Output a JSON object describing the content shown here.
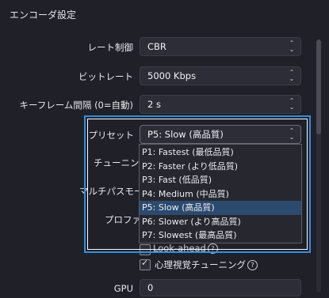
{
  "section_title": "エンコーダ設定",
  "rate_control": {
    "label": "レート制御",
    "value": "CBR"
  },
  "bitrate": {
    "label": "ビットレート",
    "value": "5000 Kbps"
  },
  "keyframe": {
    "label": "キーフレーム間隔 (0=自動)",
    "value": "2 s"
  },
  "preset": {
    "label": "プリセット",
    "value": "P5: Slow (高品質)"
  },
  "tuning": {
    "label": "チューニング"
  },
  "multipass": {
    "label": "マルチパスモード"
  },
  "profile": {
    "label": "プロファイル"
  },
  "lookahead": {
    "label": "Look-ahead"
  },
  "psycho_visual": {
    "label": "心理視覚チューニング",
    "checked": true
  },
  "gpu": {
    "label": "GPU",
    "value": "0"
  },
  "preset_options": [
    "P1: Fastest (最低品質)",
    "P2: Faster (より低品質)",
    "P3: Fast (低品質)",
    "P4: Medium (中品質)",
    "P5: Slow (高品質)",
    "P6: Slower (より高品質)",
    "P7: Slowest (最高品質)"
  ],
  "selected_index": 4,
  "colors": {
    "accent": "#2f8fdf",
    "selection": "#2c4a6e"
  }
}
